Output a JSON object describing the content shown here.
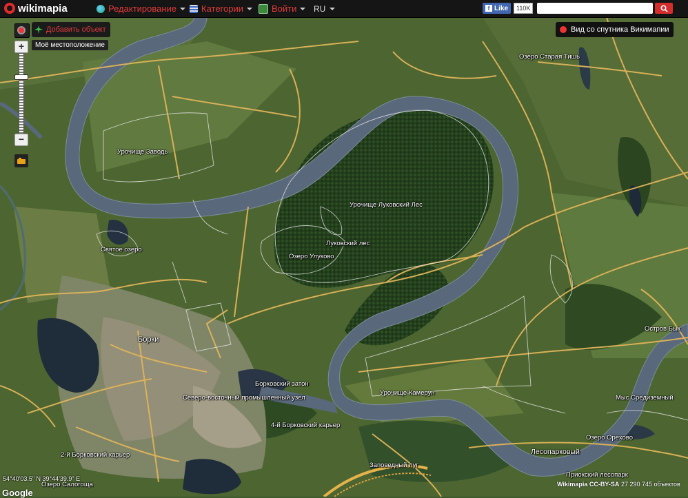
{
  "header": {
    "logo_text": "wikimapia",
    "menu": [
      {
        "label": "Редактирование",
        "icon": "globe-icon"
      },
      {
        "label": "Категории",
        "icon": "list-icon"
      },
      {
        "label": "Войти",
        "icon": "login-icon"
      }
    ],
    "language": "RU",
    "facebook": {
      "like_label": "Like",
      "count": "110K"
    },
    "search": {
      "placeholder": "",
      "value": ""
    }
  },
  "controls": {
    "add_object_label": "Добавить объект",
    "my_location_label": "Моё местоположение",
    "satellite_label": "Вид со спутника Викимапии",
    "zoom_in": "+",
    "zoom_out": "−",
    "zoom_level": 0.72
  },
  "places": [
    {
      "id": "staraya-tish",
      "label": "Озеро Старая Тишь"
    },
    {
      "id": "zavod",
      "label": "Урочище Заводь"
    },
    {
      "id": "lukovsky-les-tract",
      "label": "Урочище Луковский Лес"
    },
    {
      "id": "lukovsky-les",
      "label": "Луковский лес"
    },
    {
      "id": "ulukovo",
      "label": "Озеро Улуково"
    },
    {
      "id": "svyatoe",
      "label": "Святое озеро"
    },
    {
      "id": "borki",
      "label": "Борки"
    },
    {
      "id": "zaton",
      "label": "Борковский затон"
    },
    {
      "id": "uzel",
      "label": "Северо-восточный промышленный узел"
    },
    {
      "id": "kamerun",
      "label": "Урочище Камерун"
    },
    {
      "id": "karier4",
      "label": "4-й Борковский карьер"
    },
    {
      "id": "karier2",
      "label": "2-й Борковский карьер"
    },
    {
      "id": "salogosha",
      "label": "Озеро Салогоща"
    },
    {
      "id": "zapovedny",
      "label": "Заповедный луг"
    },
    {
      "id": "ostrov-byk",
      "label": "Остров Бык"
    },
    {
      "id": "mys",
      "label": "Мыс Средиземный"
    },
    {
      "id": "orehovoe",
      "label": "Озеро Орехово"
    },
    {
      "id": "lesopark",
      "label": "Лесопарковый"
    },
    {
      "id": "priokskiy",
      "label": "Приокский лесопарк"
    }
  ],
  "footer": {
    "coordinates": "54°40'03.5\" N 39°44'39.9\" E",
    "google": "Google",
    "credit_brand": "Wikimapia CC-BY-SA",
    "object_count": "27 290 745 объектов"
  },
  "colors": {
    "header_bg": "#151515",
    "accent_red": "#e23b3b",
    "road": "#e6b85a",
    "river": "#5d6b7a",
    "forest": "#2c4a22",
    "field": "#5b7338"
  }
}
